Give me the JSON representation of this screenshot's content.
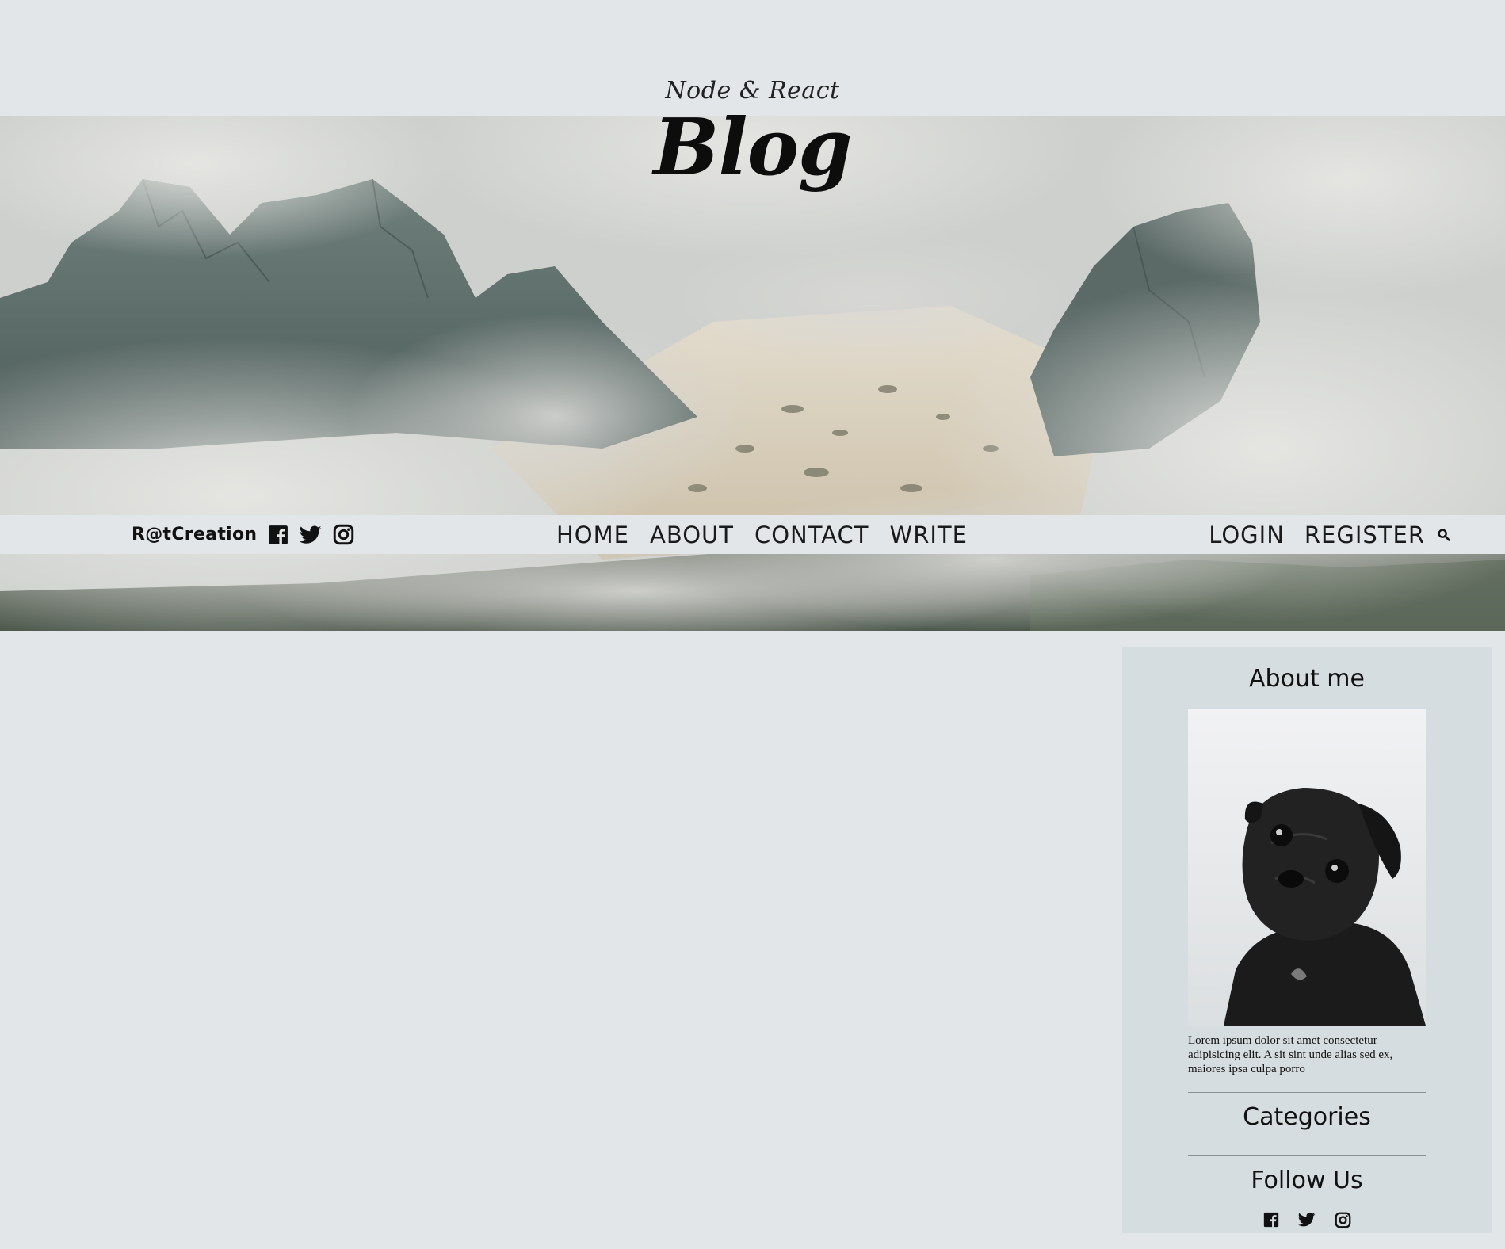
{
  "header": {
    "subtitle": "Node & React",
    "title": "Blog"
  },
  "topbar": {
    "brand": "R@tCreation",
    "social_icons": [
      "facebook-icon",
      "twitter-icon",
      "instagram-icon"
    ],
    "nav": [
      {
        "label": "HOME"
      },
      {
        "label": "ABOUT"
      },
      {
        "label": "CONTACT"
      },
      {
        "label": "WRITE"
      }
    ],
    "auth": {
      "login": "LOGIN",
      "register": "REGISTER"
    }
  },
  "sidebar": {
    "about_title": "About me",
    "about_text": "Lorem ipsum dolor sit amet consectetur adipisicing elit. A sit sint unde alias sed ex, maiores ipsa culpa porro",
    "categories_title": "Categories",
    "follow_title": "Follow Us",
    "follow_icons": [
      "facebook-icon",
      "twitter-icon",
      "instagram-icon"
    ]
  }
}
